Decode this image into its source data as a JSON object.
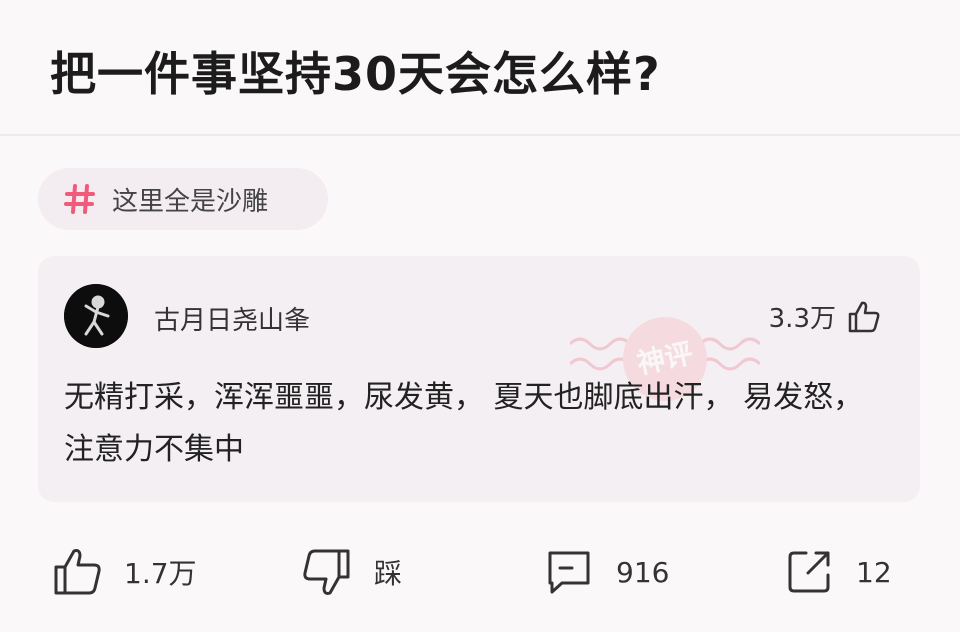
{
  "question": {
    "title": "把一件事坚持30天会怎么样?"
  },
  "tag": {
    "icon": "hashtag-icon",
    "label": "这里全是沙雕",
    "color": "#f25a7a"
  },
  "comment": {
    "username": "古月日尧山夆",
    "likes": "3.3万",
    "text": "无精打采，浑浑噩噩，尿发黄， 夏天也脚底出汗， 易发怒，注意力不集中",
    "stamp_label": "神评"
  },
  "actions": {
    "like": {
      "icon": "thumbs-up-icon",
      "label": "1.7万"
    },
    "dislike": {
      "icon": "thumbs-down-icon",
      "label": "踩"
    },
    "comment": {
      "icon": "comment-icon",
      "label": "916"
    },
    "share": {
      "icon": "share-icon",
      "label": "12"
    }
  }
}
